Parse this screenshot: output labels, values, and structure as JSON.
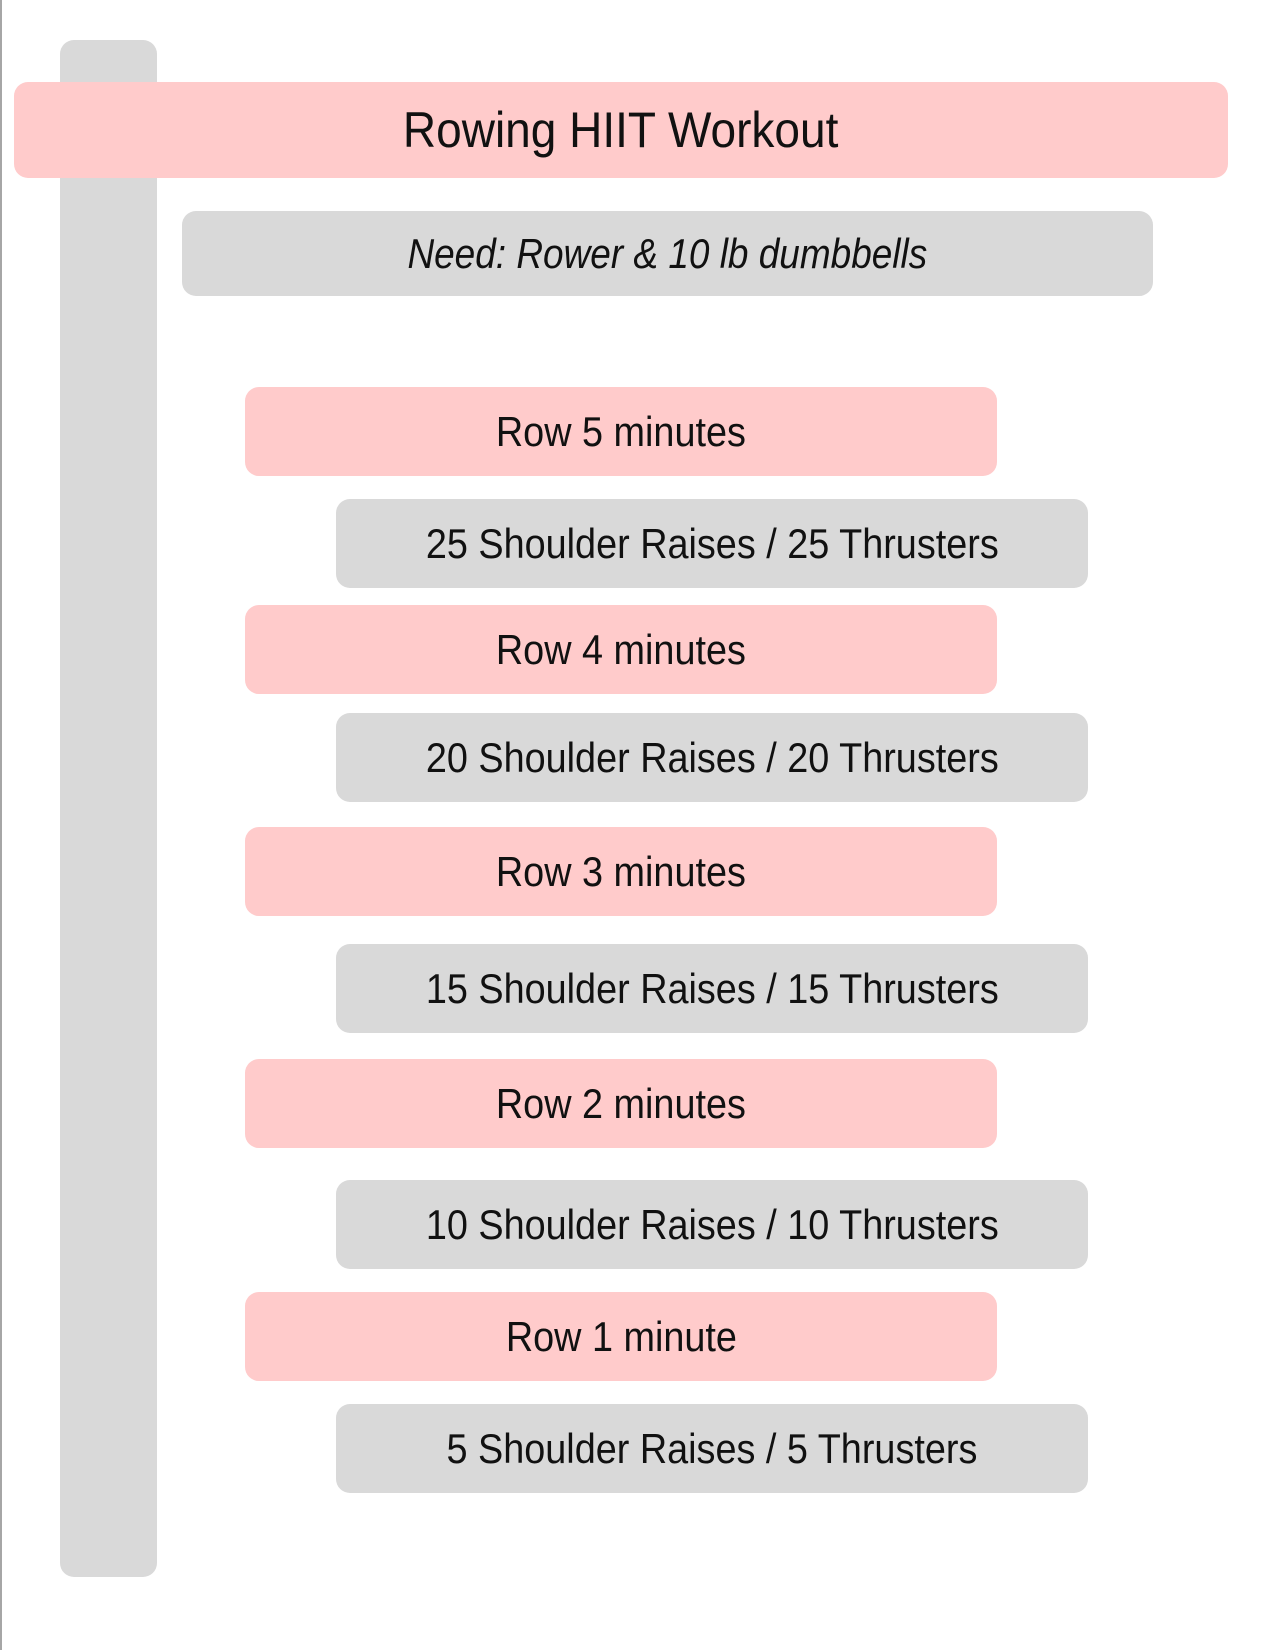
{
  "title": "Rowing HIIT Workout",
  "equipment": "Need: Rower & 10 lb dumbbells",
  "colors": {
    "row_box": "#ffcbcb",
    "rep_box": "#d9d9d9",
    "side_bar": "#d9d9d9"
  },
  "steps": [
    {
      "row": "Row 5 minutes",
      "reps": "25 Shoulder Raises / 25 Thrusters"
    },
    {
      "row": "Row 4 minutes",
      "reps": "20 Shoulder Raises / 20 Thrusters"
    },
    {
      "row": "Row 3 minutes",
      "reps": "15 Shoulder Raises / 15 Thrusters"
    },
    {
      "row": "Row 2 minutes",
      "reps": "10 Shoulder Raises / 10 Thrusters"
    },
    {
      "row": "Row 1 minute",
      "reps": "5 Shoulder Raises / 5 Thrusters"
    }
  ]
}
